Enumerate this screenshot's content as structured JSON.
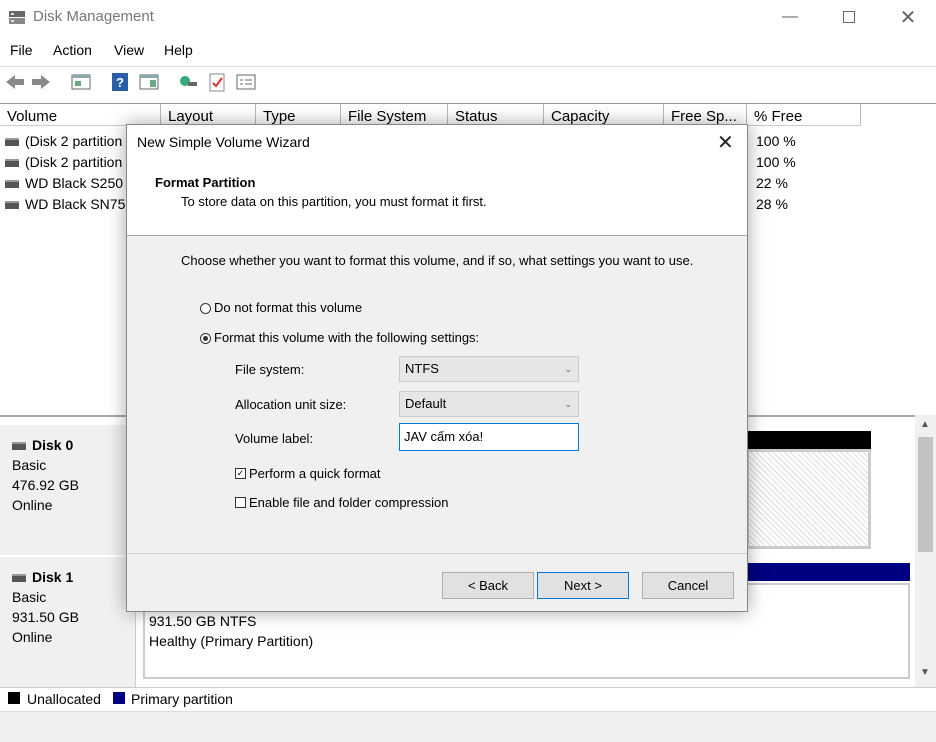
{
  "window": {
    "title": "Disk Management"
  },
  "menu": [
    "File",
    "Action",
    "View",
    "Help"
  ],
  "columns": [
    "Volume",
    "Layout",
    "Type",
    "File System",
    "Status",
    "Capacity",
    "Free Sp...",
    "% Free"
  ],
  "volumes": [
    {
      "name": "(Disk 2 partition",
      "free_pct": "100 %"
    },
    {
      "name": "(Disk 2 partition",
      "free_pct": "100 %"
    },
    {
      "name": "WD Black S250",
      "free_pct": "22 %"
    },
    {
      "name": "WD Black SN75",
      "free_pct": "28 %"
    }
  ],
  "disks": [
    {
      "title": "Disk 0",
      "type": "Basic",
      "size": "476.92 GB",
      "state": "Online"
    },
    {
      "title": "Disk 1",
      "type": "Basic",
      "size": "931.50 GB",
      "state": "Online"
    }
  ],
  "disk1_partition": {
    "line1": "931.50 GB NTFS",
    "line2": "Healthy (Primary Partition)"
  },
  "legend": {
    "unallocated": "Unallocated",
    "primary": "Primary partition"
  },
  "dialog": {
    "title": "New Simple Volume Wizard",
    "heading": "Format Partition",
    "subheading": "To store data on this partition, you must format it first.",
    "prompt": "Choose whether you want to format this volume, and if so, what settings you want to use.",
    "option_no_format": "Do not format this volume",
    "option_format": "Format this volume with the following settings:",
    "fs_label": "File system:",
    "fs_value": "NTFS",
    "alloc_label": "Allocation unit size:",
    "alloc_value": "Default",
    "vol_label": "Volume label:",
    "vol_value": "JAV cấm xóa!",
    "quick_format": "Perform a quick format",
    "compression": "Enable file and folder compression",
    "back": "< Back",
    "next": "Next >",
    "cancel": "Cancel"
  }
}
